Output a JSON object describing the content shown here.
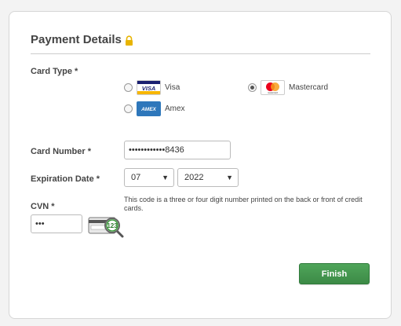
{
  "form": {
    "title": "Payment Details",
    "card_type_label": "Card Type *",
    "card_options": [
      {
        "label": "Visa",
        "logo_text": "VISA",
        "selected": false
      },
      {
        "label": "Mastercard",
        "logo_text": "mastercard",
        "selected": true
      },
      {
        "label": "Amex",
        "logo_text": "AMEX",
        "selected": false
      }
    ],
    "card_number_label": "Card Number *",
    "card_number_value": "••••••••••••8436",
    "expiration_label": "Expiration Date *",
    "exp_month": "07",
    "exp_year": "2022",
    "cvn_label": "CVN *",
    "cvn_value": "•••",
    "cvn_hint": "This code is a three or four digit number printed on the back or front of credit cards.",
    "cvn_card_text": "123",
    "finish_label": "Finish"
  },
  "colors": {
    "accent_green": "#3f8f4a",
    "lock_yellow": "#e8b400",
    "visa_blue": "#1a1f71",
    "amex_blue": "#2e77bb",
    "mc_red": "#eb001b",
    "mc_orange": "#f79e1b"
  },
  "icons": {
    "lock": "lock-icon",
    "visa": "visa-logo-icon",
    "mastercard": "mastercard-logo-icon",
    "amex": "amex-logo-icon",
    "cvn": "cvn-card-magnifier-icon"
  }
}
